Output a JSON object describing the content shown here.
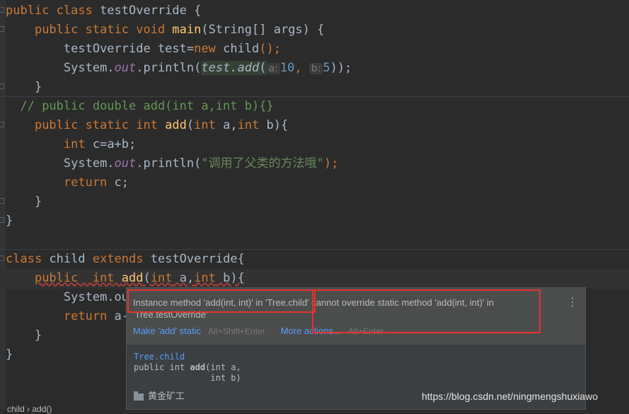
{
  "code": {
    "l1": {
      "kw": "public class ",
      "name": "testOverride {"
    },
    "l2": {
      "kw": "public static void ",
      "fn": "main",
      "rest": "(String[] args) {"
    },
    "l3": {
      "a": "testOverride test=",
      "kw": "new ",
      "b": "child",
      "c": "();"
    },
    "l4": {
      "a": "System.",
      "field": "out",
      "b": ".println(",
      "call": "test.add",
      "hint_a": "a:",
      "num_a": "10",
      "sep": ",",
      "hint_b": "b:",
      "num_b": "5",
      "end": "));"
    },
    "l5": "}",
    "l6": "// public double add(int a,int b){}",
    "l7": {
      "kw": "public static int ",
      "fn": "add",
      "p1": "(",
      "t1": "int",
      "p2": " a,",
      "t2": "int",
      "p3": " b){"
    },
    "l8": {
      "kw": "int ",
      "rest": "c=a+b;"
    },
    "l9": {
      "a": "System.",
      "field": "out",
      "b": ".println(",
      "str": "\"调用了父类的方法哦\"",
      "end": ");"
    },
    "l10": {
      "kw": "return ",
      "rest": "c;"
    },
    "l11": "}",
    "l12": "}",
    "l13": {
      "kw": "class ",
      "name": "child ",
      "kw2": "extends ",
      "rest": "testOverride{"
    },
    "l14": {
      "kw": "public  int ",
      "fn": "add",
      "p1": "(",
      "t1": "int",
      "p2": " a,",
      "t2": "int",
      "p3": " b){"
    },
    "l15": {
      "a": "System.ou"
    },
    "l16": {
      "kw": "return ",
      "rest": "a-"
    },
    "l17": "}",
    "l18": "}"
  },
  "popup": {
    "message_part1": "Instance method 'add(int, int)' in 'Tree.child' ",
    "message_part2": "cannot override static method 'add(int, int)' in",
    "message_part3": "'Tree.testOverride'",
    "action_fix": "Make 'add' static",
    "action_fix_shortcut": "Alt+Shift+Enter",
    "action_more": "More actions...",
    "action_more_shortcut": "Alt+Enter",
    "menu_icon": "⋮",
    "doc_class": "Tree.child",
    "doc_sig1_a": "public int ",
    "doc_sig1_b": "add",
    "doc_sig1_c": "(int a,",
    "doc_sig2": "               int b)",
    "footer_module": "黄金矿工"
  },
  "watermark": "https://blog.csdn.net/ningmengshuxiawo",
  "breadcrumb": "child  ›  add()",
  "colors": {
    "keyword": "#cc7832",
    "function": "#ffc66d",
    "string": "#6a8759",
    "number": "#6897bb",
    "error_box": "#e5322d"
  }
}
